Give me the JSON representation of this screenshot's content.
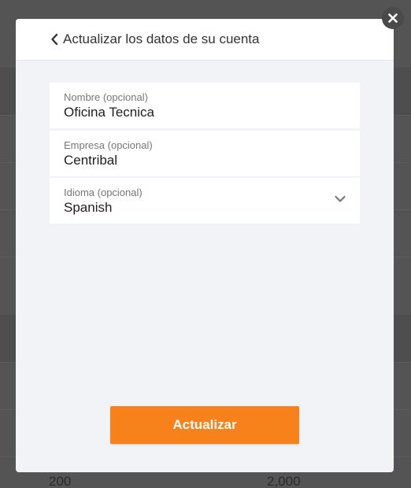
{
  "background": {
    "row_values": [
      "200",
      "2,000"
    ]
  },
  "modal": {
    "title": "Actualizar los datos de su cuenta",
    "back_icon": "chevron-left-icon",
    "close_icon": "close-icon",
    "fields": [
      {
        "label": "Nombre (opcional)",
        "value": "Oficina Tecnica"
      },
      {
        "label": "Empresa (opcional)",
        "value": "Centribal"
      },
      {
        "label": "Idioma (opcional)",
        "value": "Spanish",
        "icon": "chevron-down-icon"
      }
    ],
    "submit_label": "Actualizar"
  },
  "colors": {
    "accent": "#f7821b",
    "modal_body": "#f2f3f7",
    "overlay": "#545454"
  }
}
